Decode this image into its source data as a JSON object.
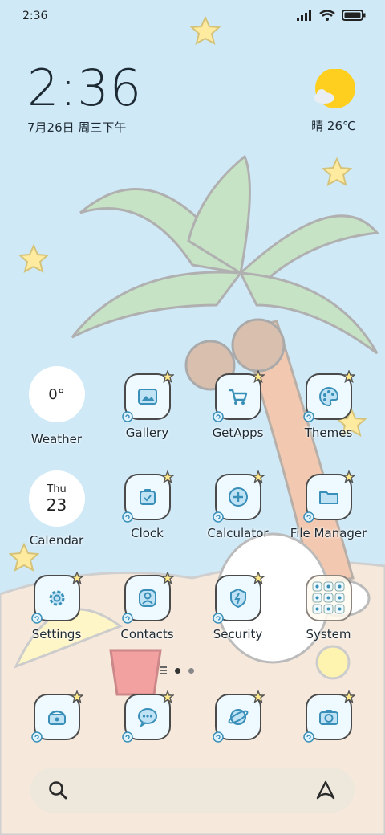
{
  "status_bar": {
    "time": "2:36",
    "icons": [
      "signal-icon",
      "wifi-icon",
      "battery-icon"
    ]
  },
  "clock_widget": {
    "time": "2:36",
    "date": "7月26日 周三下午"
  },
  "weather_widget": {
    "condition_icon": "sun-cloud-icon",
    "temp": "晴 26℃"
  },
  "apps": {
    "weather": {
      "label": "Weather",
      "value": "0°"
    },
    "gallery": {
      "label": "Gallery"
    },
    "getapps": {
      "label": "GetApps"
    },
    "themes": {
      "label": "Themes"
    },
    "calendar": {
      "label": "Calendar",
      "weekday": "Thu",
      "day": "23"
    },
    "clock": {
      "label": "Clock"
    },
    "calculator": {
      "label": "Calculator"
    },
    "filemanager": {
      "label": "File Manager"
    },
    "settings": {
      "label": "Settings"
    },
    "contacts": {
      "label": "Contacts"
    },
    "security": {
      "label": "Security"
    },
    "system": {
      "label": "System"
    }
  },
  "dock": [
    "phone-icon",
    "messages-icon",
    "browser-icon",
    "camera-icon"
  ],
  "page_indicator": {
    "pages": 3,
    "active": 2
  },
  "search_bar": {
    "left_icon": "search-icon",
    "right_icon": "assistant-icon"
  },
  "colors": {
    "sky": "#cfe9f7",
    "sand": "#f6e9dc",
    "tile": "#eefaff",
    "accent": "#3a8fb8",
    "star": "#ffe98a"
  }
}
